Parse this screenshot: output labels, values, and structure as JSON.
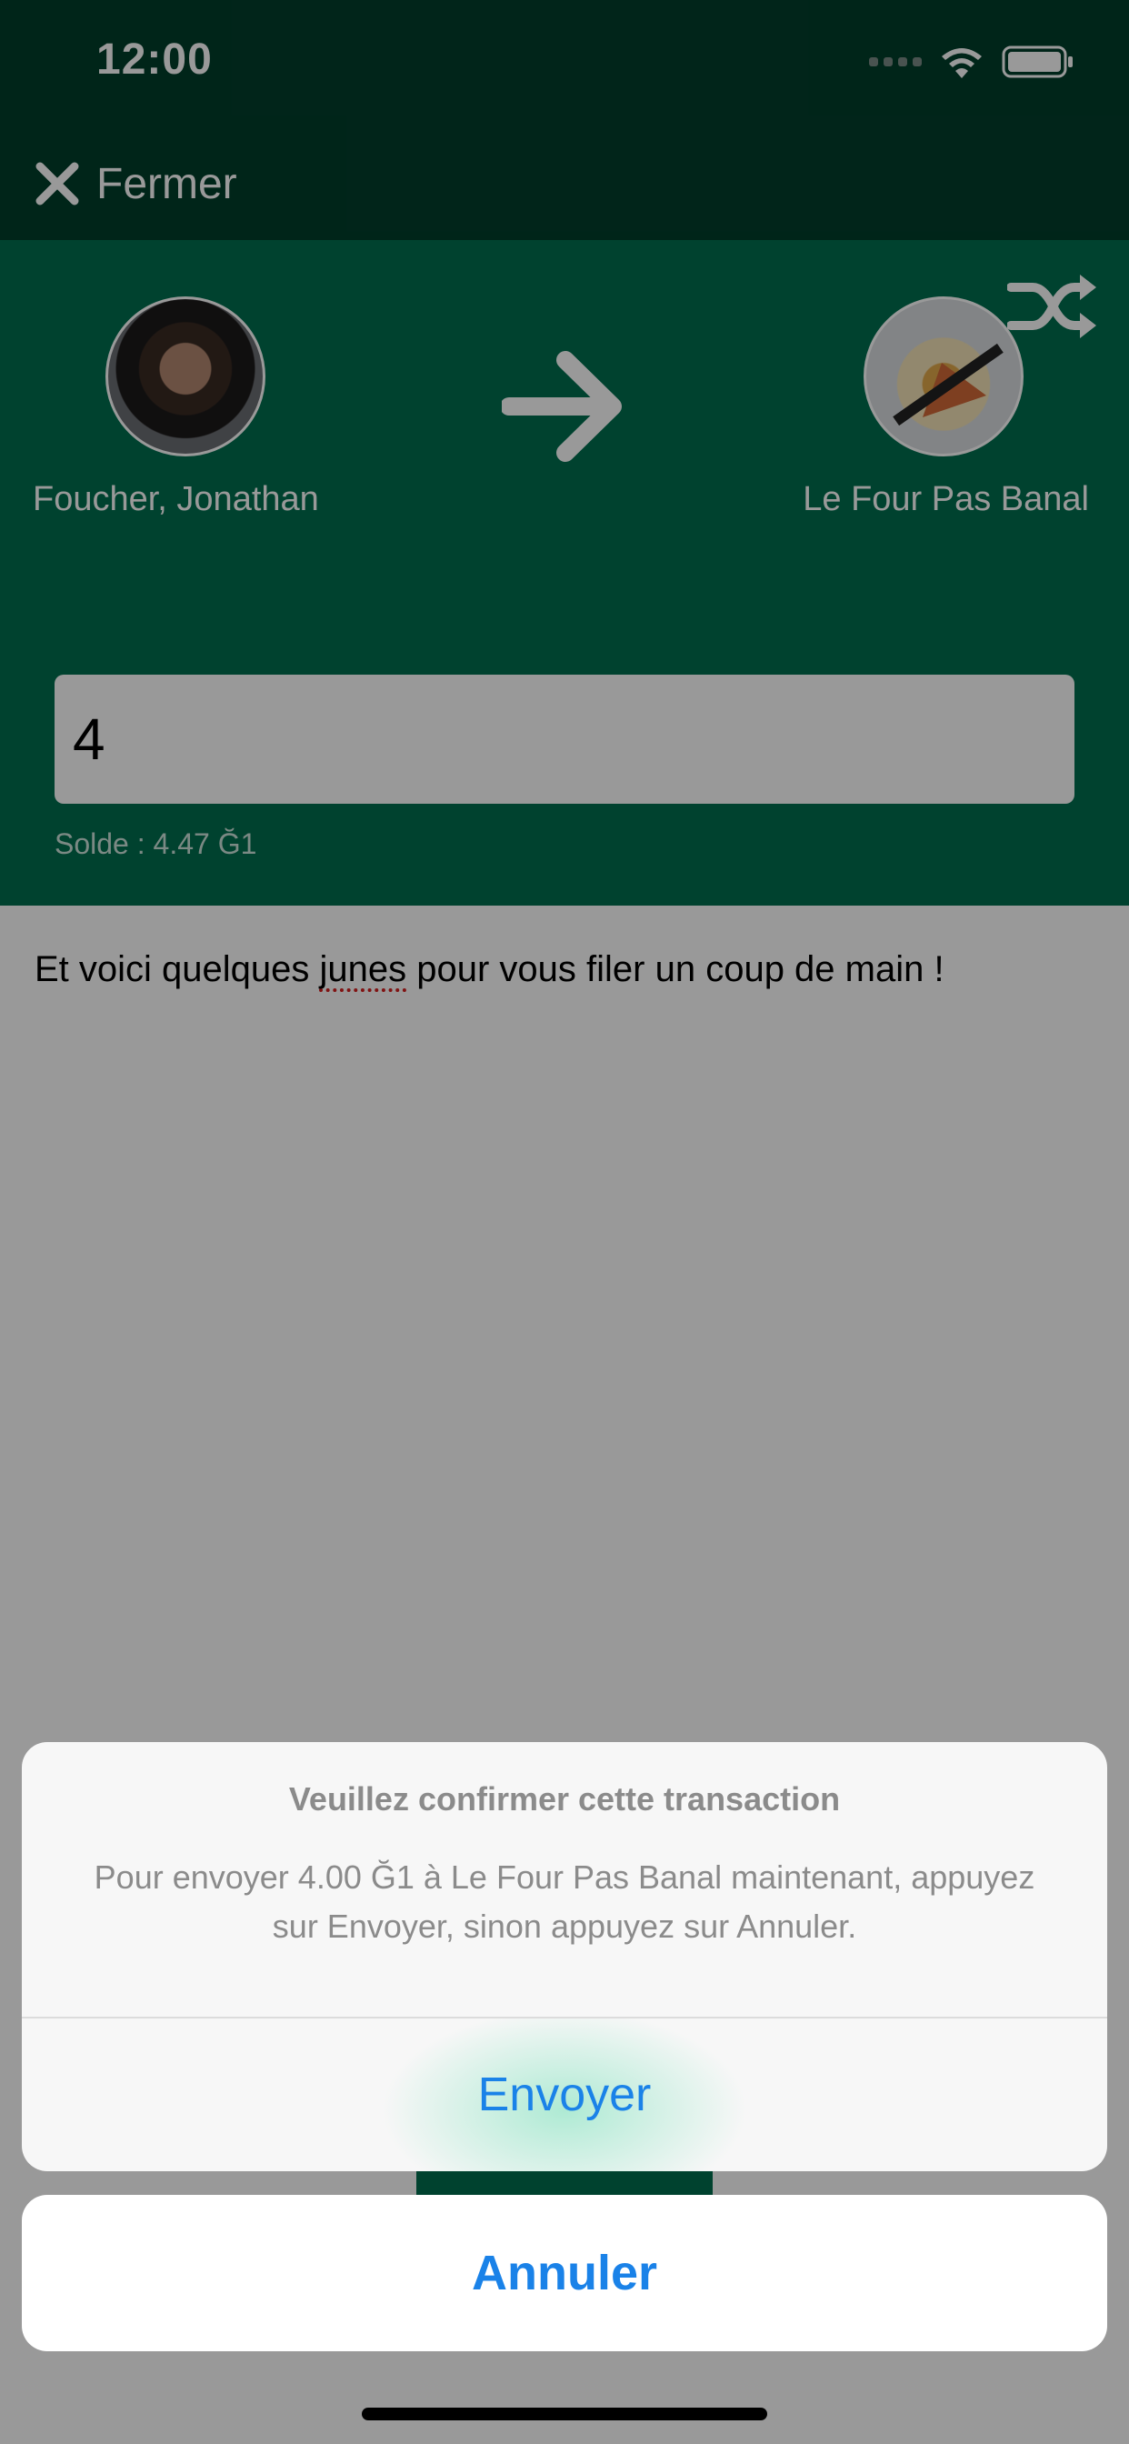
{
  "status_bar": {
    "time": "12:00"
  },
  "nav": {
    "close_label": "Fermer"
  },
  "transfer": {
    "sender_name": "Foucher, Jonathan",
    "recipient_name": "Le Four Pas Banal"
  },
  "amount": {
    "value": "4"
  },
  "balance": {
    "text": "Solde :  4.47 Ğ1"
  },
  "comment": {
    "before": "Et voici quelques ",
    "misspelled": "junes",
    "after": " pour vous filer un coup de main !"
  },
  "dialog": {
    "title": "Veuillez confirmer cette transaction",
    "message": "Pour envoyer 4.00 Ğ1 à Le Four Pas Banal maintenant, appuyez sur Envoyer, sinon appuyez sur Annuler.",
    "confirm_label": "Envoyer",
    "cancel_label": "Annuler"
  },
  "colors": {
    "header_green": "#006e4f",
    "topbar_dark": "#013e2b",
    "ios_blue": "#1a82e8"
  }
}
